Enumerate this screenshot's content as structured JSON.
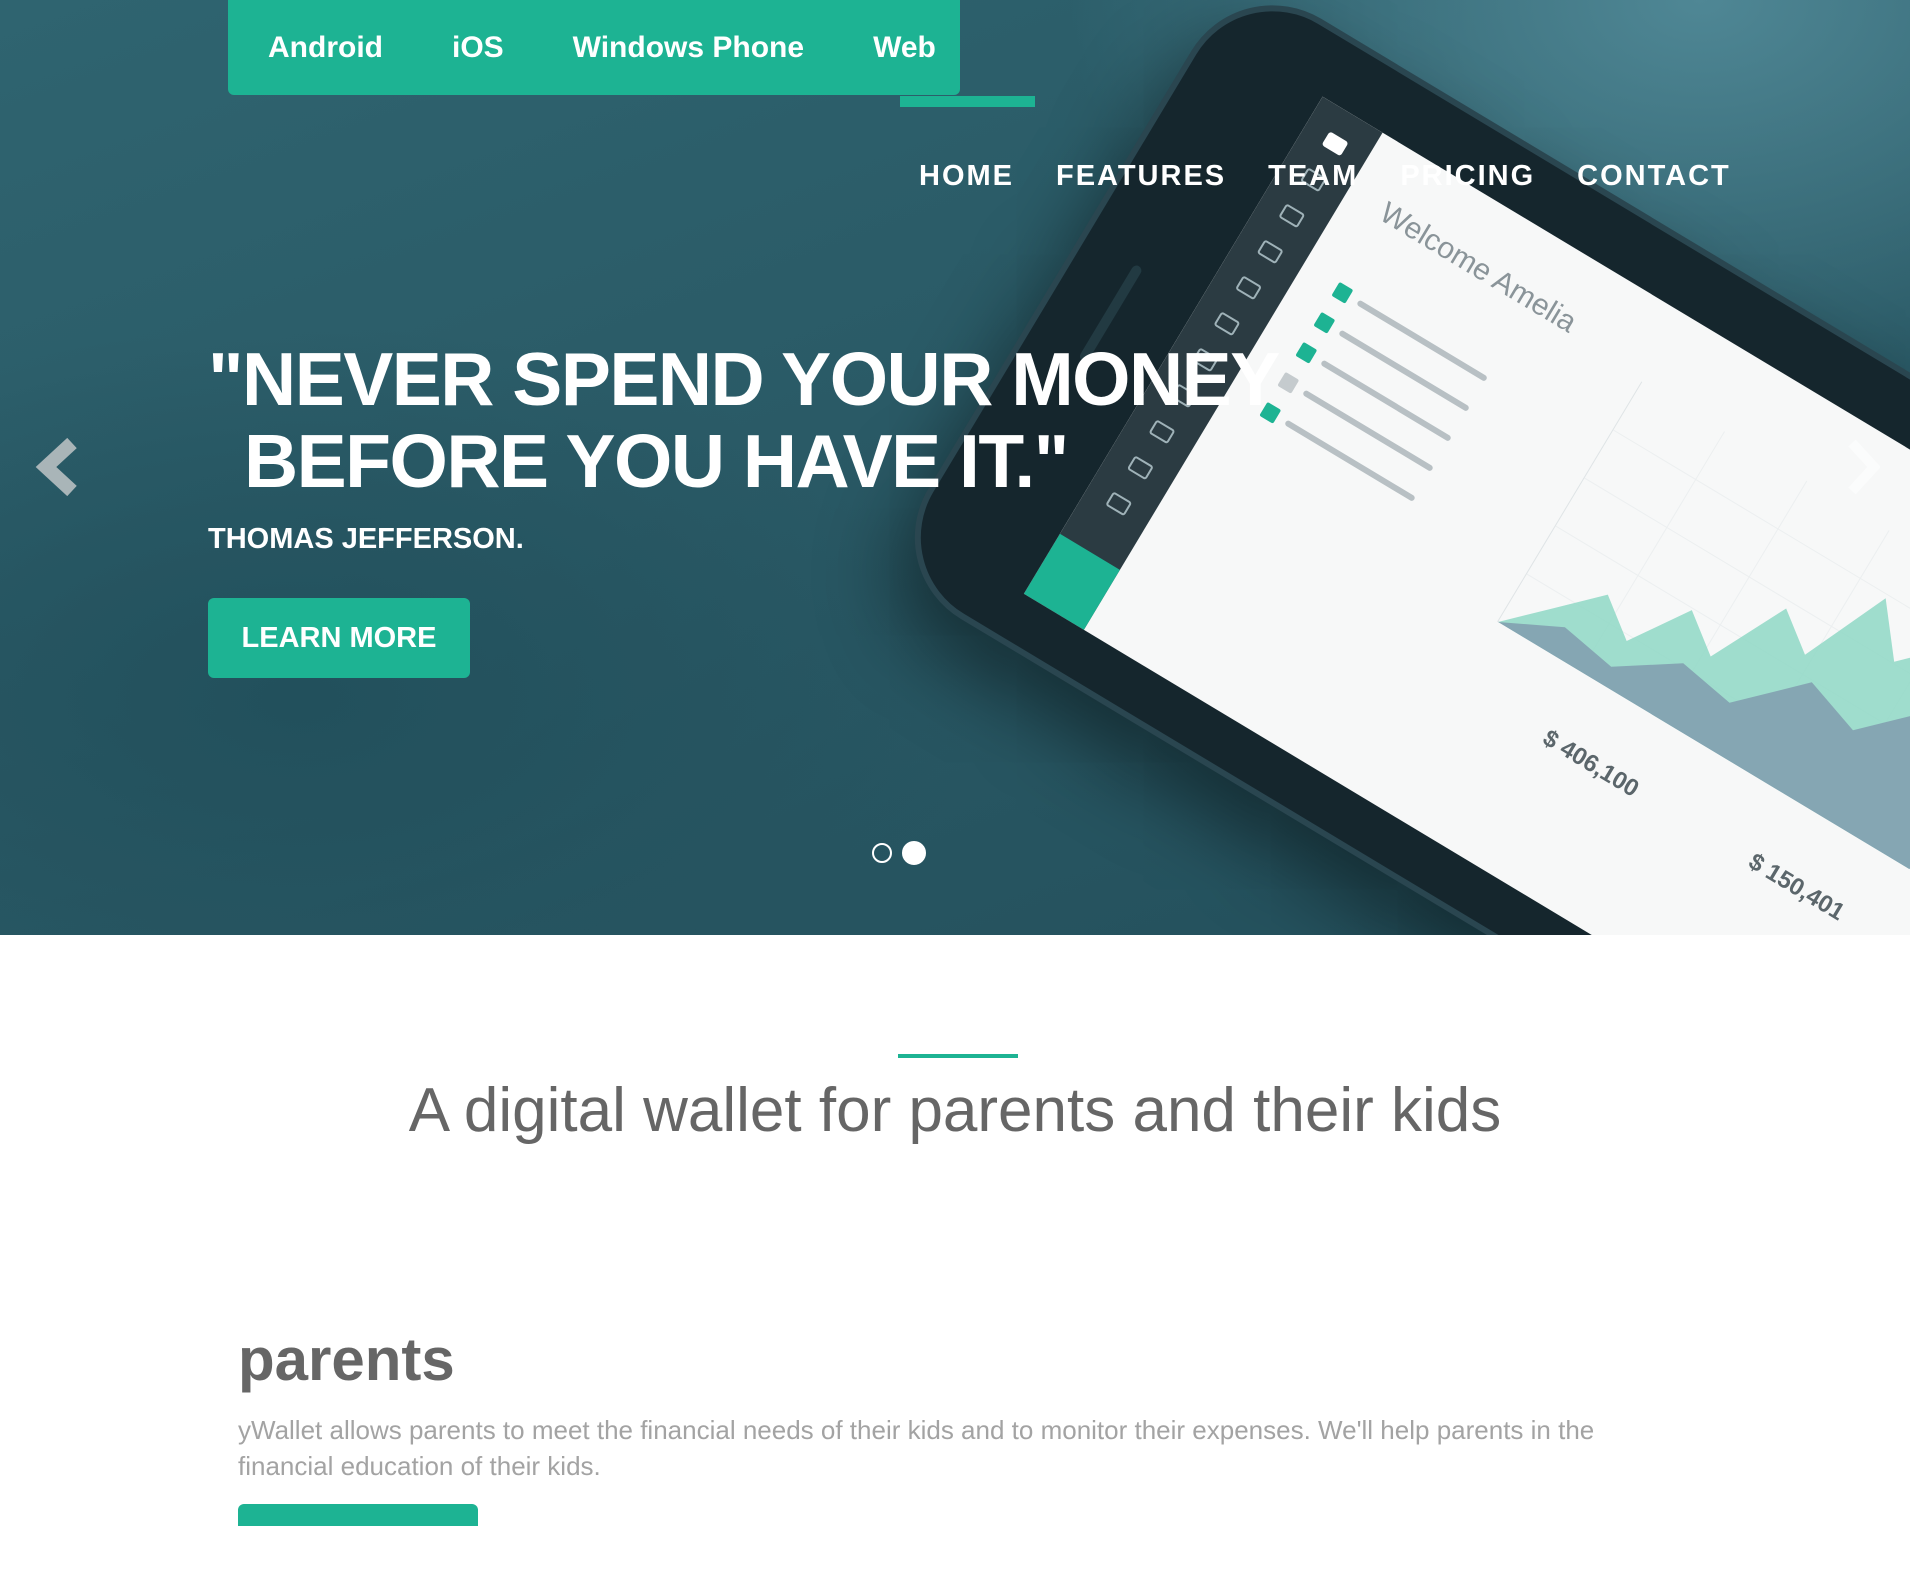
{
  "platform_tabs": [
    "Android",
    "iOS",
    "Windows Phone",
    "Web"
  ],
  "nav": [
    "HOME",
    "FEATURES",
    "TEAM",
    "PRICING",
    "CONTACT"
  ],
  "hero": {
    "quote_line1": "\"NEVER SPEND YOUR MONEY",
    "quote_line2": "BEFORE YOU HAVE IT.\"",
    "author": "THOMAS JEFFERSON.",
    "cta_label": "LEARN MORE",
    "slides_count": 2,
    "active_slide": 2
  },
  "phone_screen": {
    "welcome": "Welcome Amelia",
    "stat_1": "$ 406,100",
    "stat_2": "$ 150,401"
  },
  "content": {
    "tagline": "A digital wallet for parents and their kids",
    "parents_heading": "parents",
    "parents_text": "yWallet allows parents to meet the financial needs of their kids and to monitor their expenses. We'll help parents in the financial education of their kids."
  },
  "colors": {
    "accent": "#1db393",
    "hero_bg": "#2a5a66",
    "heading_gray": "#666666",
    "body_gray": "#a3a3a3"
  },
  "icons": [
    "chevron-left-icon",
    "chevron-right-icon"
  ]
}
